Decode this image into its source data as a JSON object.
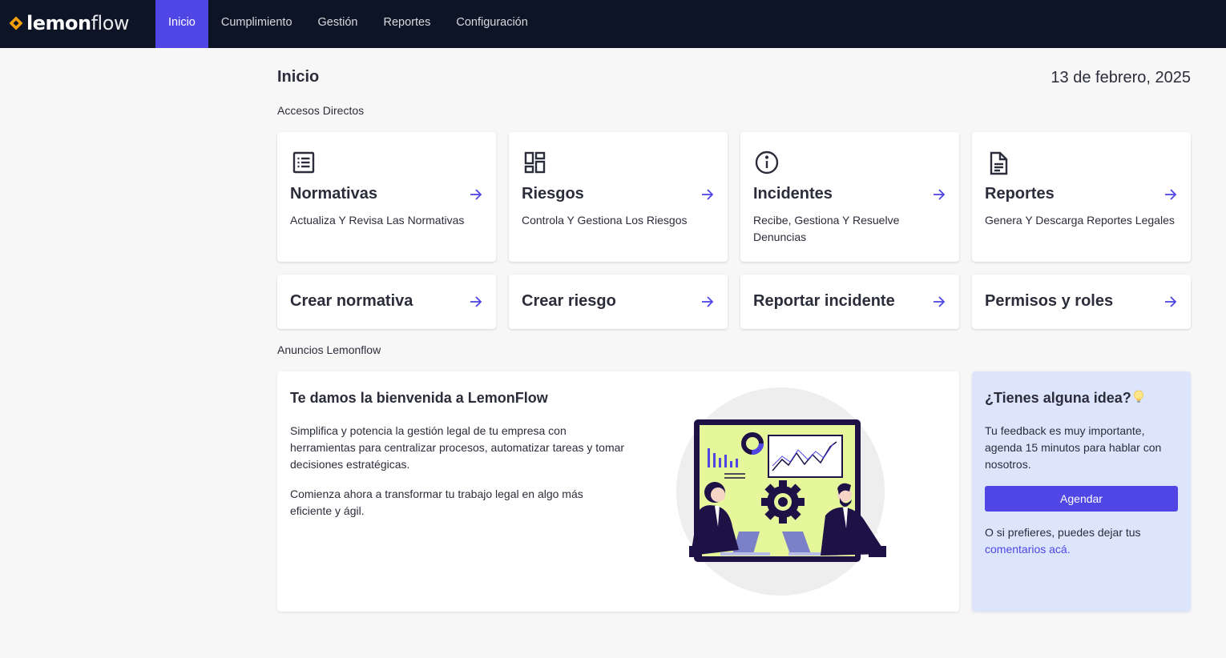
{
  "app": {
    "logo_bold": "lemon",
    "logo_light": "flow"
  },
  "nav": {
    "items": [
      {
        "label": "Inicio",
        "active": true
      },
      {
        "label": "Cumplimiento"
      },
      {
        "label": "Gestión"
      },
      {
        "label": "Reportes"
      },
      {
        "label": "Configuración"
      }
    ]
  },
  "header": {
    "title": "Inicio",
    "date": "13 de febrero, 2025"
  },
  "shortcuts": {
    "label": "Accesos Directos",
    "cards": [
      {
        "icon": "list-icon",
        "title": "Normativas",
        "desc": "Actualiza Y Revisa Las Normativas"
      },
      {
        "icon": "dashboard-icon",
        "title": "Riesgos",
        "desc": "Controla Y Gestiona Los Riesgos"
      },
      {
        "icon": "info-icon",
        "title": "Incidentes",
        "desc": "Recibe, Gestiona Y Resuelve Denuncias"
      },
      {
        "icon": "document-icon",
        "title": "Reportes",
        "desc": "Genera Y Descarga Reportes Legales"
      }
    ],
    "quick": [
      {
        "title": "Crear normativa"
      },
      {
        "title": "Crear riesgo"
      },
      {
        "title": "Reportar incidente"
      },
      {
        "title": "Permisos y roles"
      }
    ]
  },
  "announcements": {
    "label": "Anuncios Lemonflow",
    "welcome": {
      "title": "Te damos la bienvenida a LemonFlow",
      "p1": "Simplifica y potencia la gestión legal de tu empresa con herramientas para centralizar procesos, automatizar tareas y tomar decisiones estratégicas.",
      "p2": "Comienza ahora a transformar tu trabajo legal en algo más eficiente y ágil."
    },
    "idea": {
      "title": "¿Tienes alguna idea?",
      "text": "Tu feedback es muy importante, agenda 15 minutos para hablar con nosotros.",
      "button": "Agendar",
      "alt_text": "O si prefieres, puedes dejar tus",
      "link": "comentarios acá."
    }
  },
  "colors": {
    "nav_bg": "#0d1425",
    "accent": "#4f46e5",
    "logo_orange": "#f59e0b",
    "idea_bg": "#dde5fd",
    "illus_green": "#e5f79a"
  }
}
